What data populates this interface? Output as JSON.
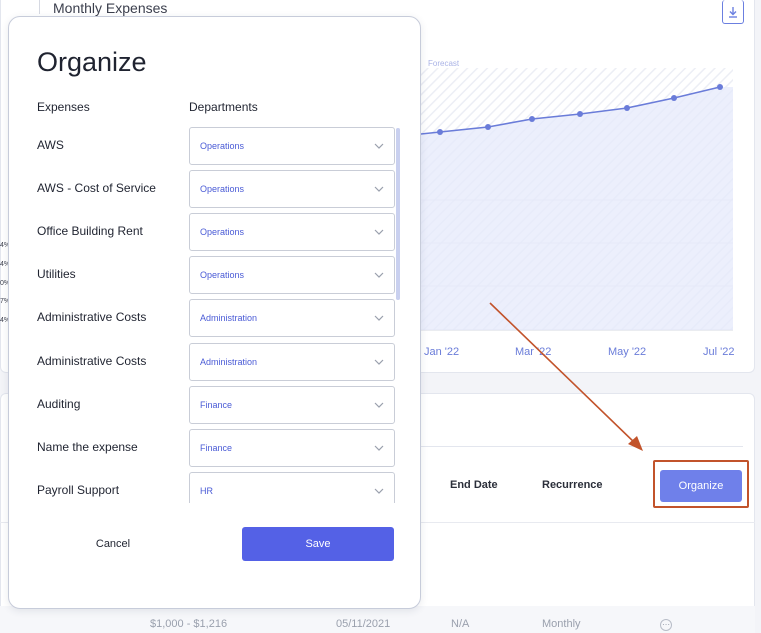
{
  "background": {
    "chart": {
      "title": "Monthly Expenses",
      "forecast_label": "Forecast",
      "x_ticks": [
        "Jan '22",
        "Mar '22",
        "May '22",
        "Jul '22"
      ],
      "side_labels": [
        "4%",
        "4%",
        "0%",
        "7%",
        "4%"
      ],
      "line_color": "#6a7cd9"
    },
    "table": {
      "columns": [
        "End Date",
        "Recurrence"
      ],
      "row": {
        "amount": "$1,000 - $1,216",
        "start_date": "05/11/2021",
        "end_date": "N/A",
        "recurrence": "Monthly"
      }
    },
    "organize_button": "Organize",
    "highlight_color": "#c2532b"
  },
  "modal": {
    "title": "Organize",
    "col_expenses": "Expenses",
    "col_departments": "Departments",
    "rows": [
      {
        "expense": "AWS",
        "department": "Operations"
      },
      {
        "expense": "AWS - Cost of Service",
        "department": "Operations"
      },
      {
        "expense": "Office Building Rent",
        "department": "Operations"
      },
      {
        "expense": "Utilities",
        "department": "Operations"
      },
      {
        "expense": "Administrative Costs",
        "department": "Administration"
      },
      {
        "expense": "Administrative Costs",
        "department": "Administration"
      },
      {
        "expense": "Auditing",
        "department": "Finance"
      },
      {
        "expense": "Name the expense",
        "department": "Finance"
      },
      {
        "expense": "Payroll Support",
        "department": "HR"
      }
    ],
    "cancel_label": "Cancel",
    "save_label": "Save",
    "accent_color": "#5461e6"
  }
}
